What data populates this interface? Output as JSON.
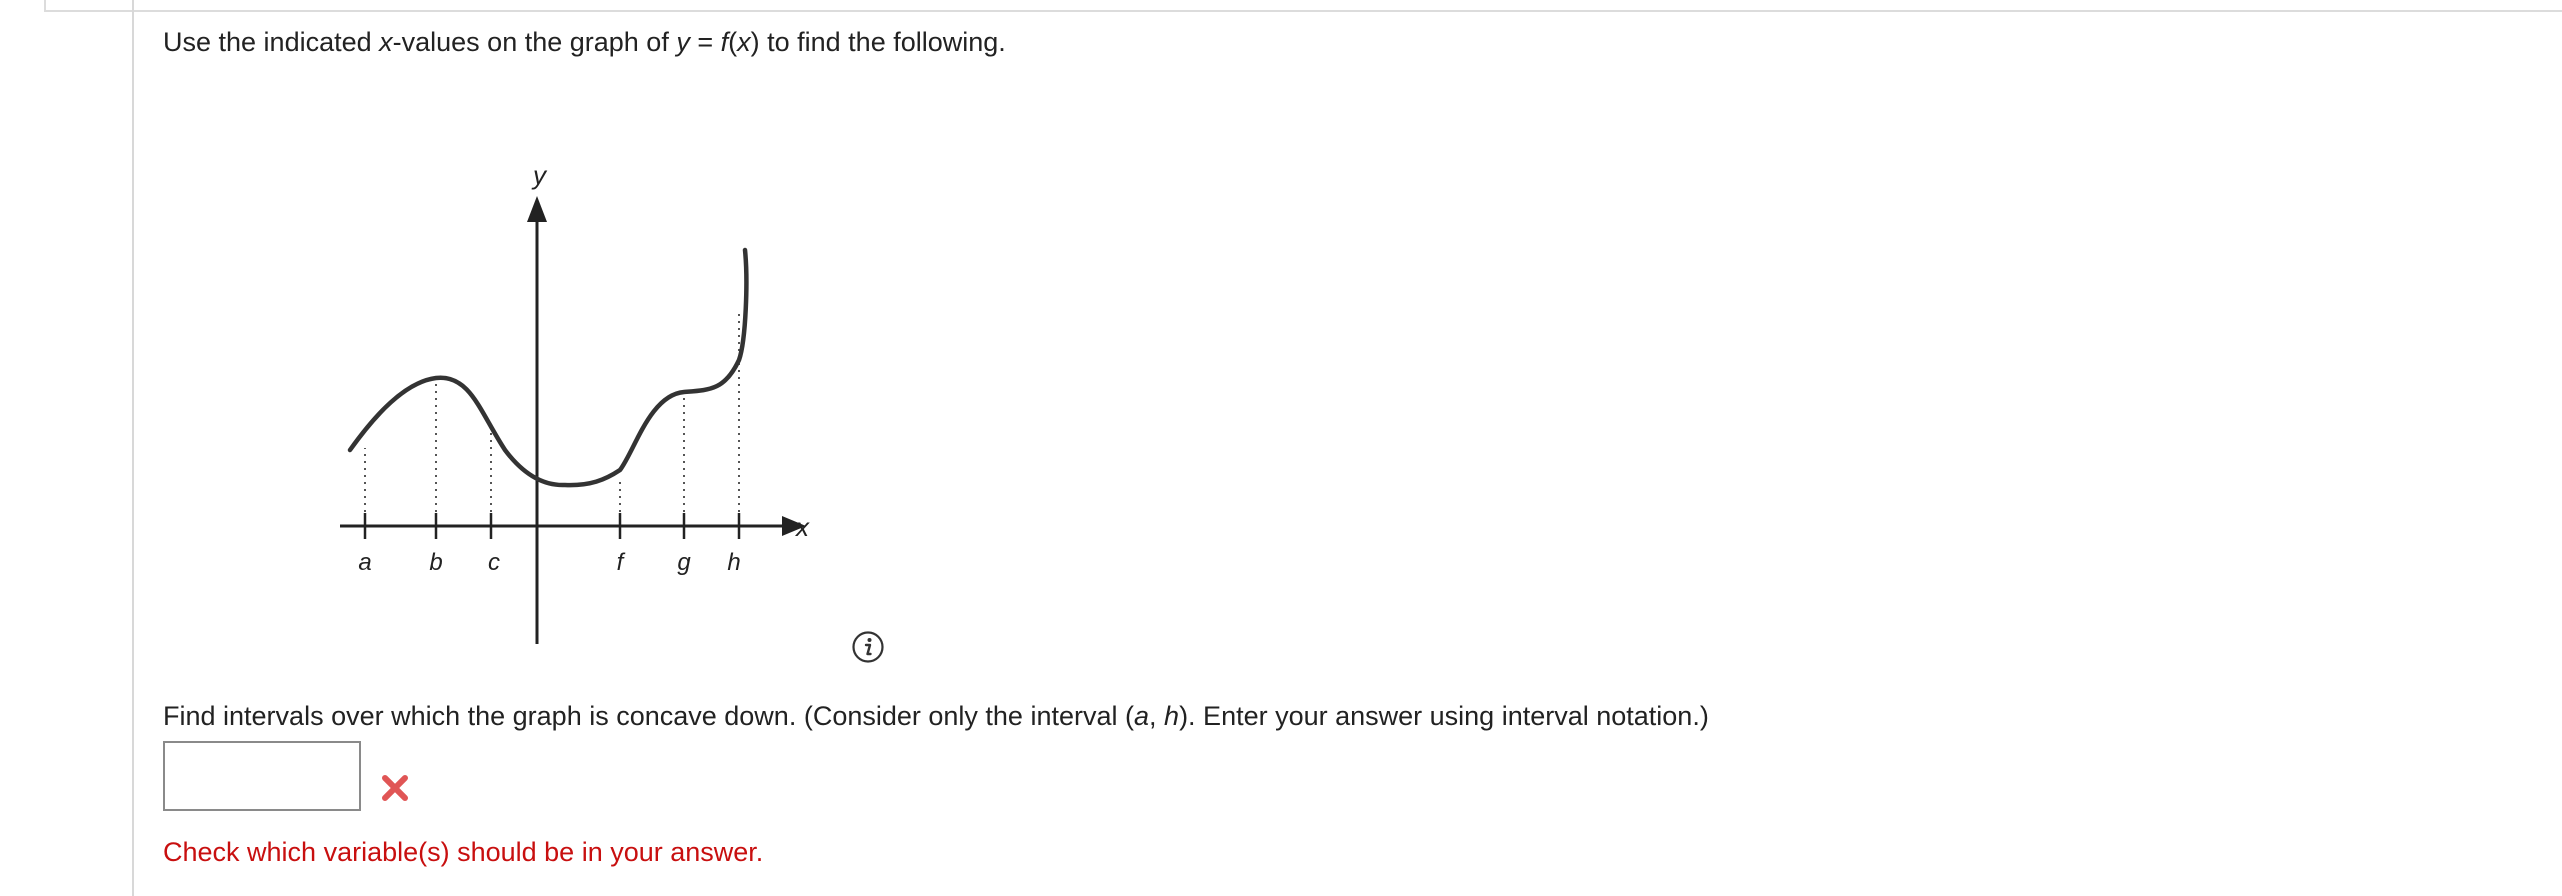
{
  "question": {
    "intro_prefix": "Use the indicated ",
    "intro_var_x": "x",
    "intro_mid": "-values on the graph of ",
    "intro_var_y": "y",
    "intro_eq": " = ",
    "intro_func": "f",
    "intro_paren_open": "(",
    "intro_func_arg": "x",
    "intro_suffix": ") to find the following."
  },
  "graph": {
    "y_axis_label": "y",
    "x_axis_label": "x",
    "tick_labels": [
      "a",
      "b",
      "c",
      "f",
      "g",
      "h"
    ]
  },
  "icons": {
    "info": "info-icon",
    "incorrect": "x-mark-icon"
  },
  "part": {
    "prompt_prefix": "Find intervals over which the graph is concave down. (Consider only the interval (",
    "prompt_var_a": "a",
    "prompt_comma": ", ",
    "prompt_var_h": "h",
    "prompt_suffix": "). Enter your answer using interval notation.)",
    "answer_value": "",
    "feedback": "Check which variable(s) should be in your answer."
  },
  "colors": {
    "text": "#222222",
    "feedback": "#c80f0f",
    "incorrect_mark": "#e05555",
    "curve": "#333333"
  }
}
